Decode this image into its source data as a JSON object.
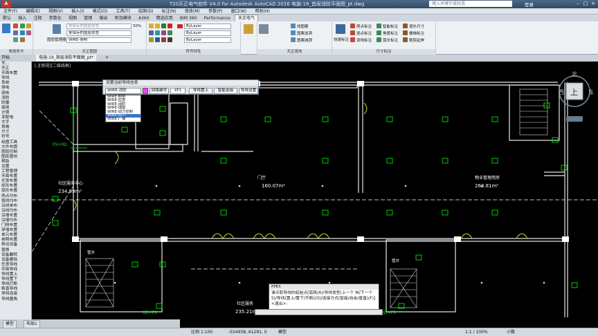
{
  "app": {
    "title": "T20天正电气软件 V4.0 for Autodesk AutoCAD 2016     电施-19_首层消防平面图_pt.dwg",
    "logo": "A",
    "search_placeholder": "键入关键字或短语",
    "user_label": "登录"
  },
  "menu": [
    "文件(F)",
    "编辑(E)",
    "视图(V)",
    "插入(I)",
    "格式(O)",
    "工具(T)",
    "绘图(D)",
    "标注(N)",
    "修改(M)",
    "参数(P)",
    "窗口(W)",
    "帮助(H)"
  ],
  "ribbon_tabs": [
    "默认",
    "插入",
    "注释",
    "参数化",
    "视图",
    "管理",
    "输出",
    "附加模块",
    "A360",
    "精选应用",
    "BIM 360",
    "Performance",
    "天正电气"
  ],
  "ribbon": {
    "panel_common": "常用命令",
    "layer_state": "未保存的图层状态",
    "layer_current": "WIRE-照明",
    "layer_manager": "图层管理器",
    "transparency": "50%",
    "panel_layers": "天正图层",
    "bylayer1": "ByLayer",
    "bylayer2": "ByLayer",
    "bylayer3": "ByLayer",
    "panel_props": "符号特性",
    "fill_buttons": [
      "线图案",
      "图案加洞",
      "图案减洞"
    ],
    "panel_fill": "天正填充",
    "quick_dim": "快速标注",
    "dim_items": [
      "两点标注",
      "逐点标注",
      "双线标注",
      "智能标注",
      "角度标注",
      "弧长标注",
      "增补尺寸",
      "楼梯标注",
      "裁剪延伸"
    ],
    "panel_dim": "尺寸标注"
  },
  "doc_tabs": {
    "start": "开始",
    "active": "电施-19_首层消防平面图_pt*"
  },
  "viewport_label": "[-][俯视][二维线框]",
  "left_tools": [
    "天...",
    "天正",
    "平面布置",
    "导线",
    "系统",
    "强电",
    "弱电",
    "消防",
    "防雷",
    "接地",
    "计算",
    "变配电",
    "文字",
    "表格",
    "尺寸",
    "符号",
    "绘图工具",
    "文件布图",
    "图层控制",
    "图库图块",
    "帮助",
    "设置",
    "工程管理",
    "平面布置",
    "任意布置",
    "矩形布置",
    "扇形布置",
    "两点均布",
    "弧线均布",
    "沿线单布",
    "沿线均布",
    "沿墙布置",
    "沿墙均布",
    "门侧布置",
    "穿墙布置",
    "单元布置",
    "参照布置",
    "移动设备",
    "替换",
    "设备翻转",
    "设备删除",
    "任意导线",
    "平面导线",
    "导线置上",
    "导线置下",
    "导线打断",
    "断直导线",
    "导线连接",
    "导线圆角"
  ],
  "dialog": {
    "caption": "设置当前导线信息",
    "combo": "WIRE-消防",
    "loop": "回路编号",
    "loop_value": "XF1",
    "up": "导线置上",
    "smart": "智能连接",
    "settings": "导线设置",
    "options": [
      "WIRE-照明",
      "WIRE-应急",
      "WIRE-消防",
      "WIRE-插座",
      "WIRE-动力控制",
      "WIRE-动力",
      "WIRE-广播"
    ],
    "selected_index": 5
  },
  "drawing": {
    "room1_name": "社区服务中心",
    "room1_area": "234.99m²",
    "room2_name": "门厅",
    "room2_area": "160.07m²",
    "room3_name": "物业管理用房",
    "room3_area": "263.81m²",
    "room4_name": "社区服务",
    "room4_area": "235.21m²",
    "well_label1": "管井",
    "well_label2": "管井",
    "tag_fs1": "FS+0D",
    "tag_fs2": "0D+FS",
    "tag_fs3": "0D+FS",
    "compass_n": "北",
    "compass_w": "西",
    "compass_e": "东",
    "compass_top": "上"
  },
  "command": {
    "header": "PPEX",
    "prompt": "请点取导线的起始点[弧段(A)/导线类型(上一个 W/下一个 S)/导线(置上/置下/不断)(O)/连接方式(智能/自由/垂直)(F)]<退出>:",
    "input": ""
  },
  "layout_tabs": [
    "模型",
    "布局1"
  ],
  "status": {
    "scale": "比例 1:100",
    "coords": "-554938, 61291, 0",
    "mode": "模型",
    "zoom": "1:1 / 100%",
    "units": "小数"
  },
  "colors": {
    "wall": "#e8e8e8",
    "grid": "#ffffff",
    "device": "#00ff00",
    "door": "#e6e62a",
    "dashed": "#ffffff",
    "ribbon_bg": "#eef1f4"
  }
}
